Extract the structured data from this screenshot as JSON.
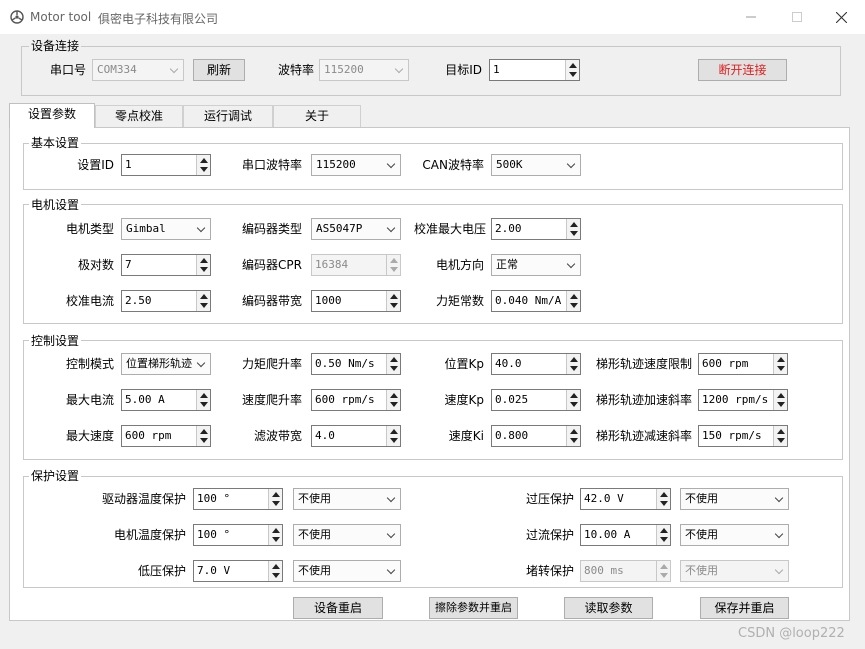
{
  "window": {
    "title": "Motor tool",
    "company": "俱密电子科技有限公司"
  },
  "connection": {
    "group_title": "设备连接",
    "port_label": "串口号",
    "port_value": "COM334",
    "refresh_label": "刷新",
    "baud_label": "波特率",
    "baud_value": "115200",
    "target_label": "目标ID",
    "target_value": "1",
    "disconnect_label": "断开连接"
  },
  "tabs": [
    {
      "label": "设置参数"
    },
    {
      "label": "零点校准"
    },
    {
      "label": "运行调试"
    },
    {
      "label": "关于"
    }
  ],
  "basic": {
    "group_title": "基本设置",
    "id_label": "设置ID",
    "id_value": "1",
    "serial_baud_label": "串口波特率",
    "serial_baud_value": "115200",
    "can_baud_label": "CAN波特率",
    "can_baud_value": "500K"
  },
  "motor": {
    "group_title": "电机设置",
    "type_label": "电机类型",
    "type_value": "Gimbal",
    "encoder_type_label": "编码器类型",
    "encoder_type_value": "AS5047P",
    "cal_voltage_label": "校准最大电压",
    "cal_voltage_value": "2.00",
    "poles_label": "极对数",
    "poles_value": "7",
    "cpr_label": "编码器CPR",
    "cpr_value": "16384",
    "direction_label": "电机方向",
    "direction_value": "正常",
    "cal_current_label": "校准电流",
    "cal_current_value": "2.50",
    "enc_bw_label": "编码器带宽",
    "enc_bw_value": "1000",
    "torque_const_label": "力矩常数",
    "torque_const_value": "0.040 Nm/A"
  },
  "control": {
    "group_title": "控制设置",
    "mode_label": "控制模式",
    "mode_value": "位置梯形轨迹",
    "torque_ramp_label": "力矩爬升率",
    "torque_ramp_value": "0.50 Nm/s",
    "pos_kp_label": "位置Kp",
    "pos_kp_value": "40.0",
    "traj_vel_label": "梯形轨迹速度限制",
    "traj_vel_value": "600 rpm",
    "max_current_label": "最大电流",
    "max_current_value": "5.00 A",
    "vel_ramp_label": "速度爬升率",
    "vel_ramp_value": "600 rpm/s",
    "vel_kp_label": "速度Kp",
    "vel_kp_value": "0.025",
    "traj_accel_label": "梯形轨迹加速斜率",
    "traj_accel_value": "1200 rpm/s",
    "max_speed_label": "最大速度",
    "max_speed_value": "600 rpm",
    "filter_bw_label": "滤波带宽",
    "filter_bw_value": "4.0",
    "vel_ki_label": "速度Ki",
    "vel_ki_value": "0.800",
    "traj_decel_label": "梯形轨迹减速斜率",
    "traj_decel_value": "150 rpm/s"
  },
  "protection": {
    "group_title": "保护设置",
    "driver_temp_label": "驱动器温度保护",
    "driver_temp_value": "100 °",
    "driver_temp_mode": "不使用",
    "motor_temp_label": "电机温度保护",
    "motor_temp_value": "100 °",
    "motor_temp_mode": "不使用",
    "undervolt_label": "低压保护",
    "undervolt_value": "7.0 V",
    "undervolt_mode": "不使用",
    "overvolt_label": "过压保护",
    "overvolt_value": "42.0 V",
    "overvolt_mode": "不使用",
    "overcurrent_label": "过流保护",
    "overcurrent_value": "10.00 A",
    "overcurrent_mode": "不使用",
    "stall_label": "堵转保护",
    "stall_value": "800 ms",
    "stall_mode": "不使用"
  },
  "actions": {
    "restart_label": "设备重启",
    "erase_label": "擦除参数并重启",
    "read_label": "读取参数",
    "save_label": "保存并重启"
  },
  "watermark": "CSDN @loop222"
}
